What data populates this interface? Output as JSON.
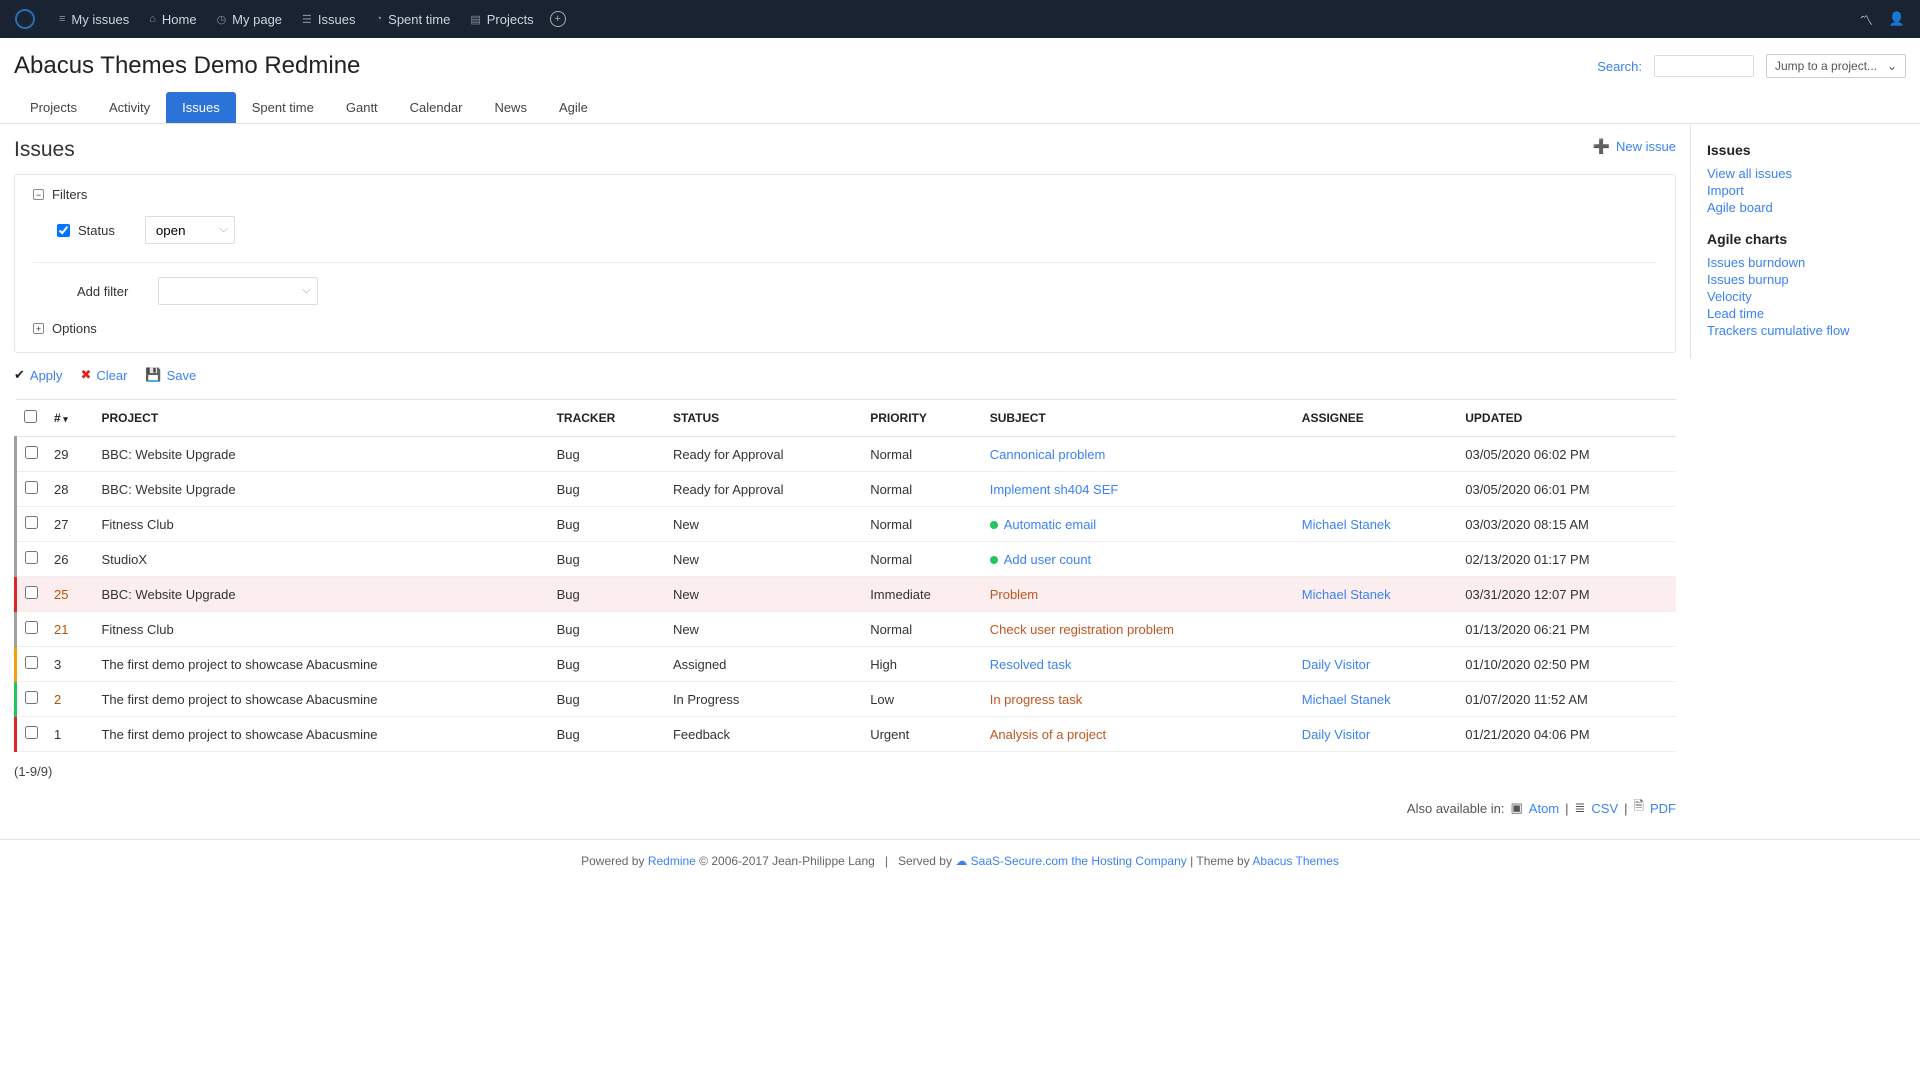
{
  "topnav": {
    "items": [
      {
        "icon": "≡",
        "label": "My issues"
      },
      {
        "icon": "⌂",
        "label": "Home"
      },
      {
        "icon": "◷",
        "label": "My page"
      },
      {
        "icon": "☰",
        "label": "Issues"
      },
      {
        "icon": "◔",
        "label": "Spent time"
      },
      {
        "icon": "▤",
        "label": "Projects"
      }
    ]
  },
  "header": {
    "title": "Abacus Themes Demo Redmine",
    "search_label": "Search:",
    "jump_label": "Jump to a project..."
  },
  "tabs": [
    "Projects",
    "Activity",
    "Issues",
    "Spent time",
    "Gantt",
    "Calendar",
    "News",
    "Agile"
  ],
  "tabs_active": "Issues",
  "page": {
    "title": "Issues",
    "new_issue": "New issue",
    "filters_label": "Filters",
    "status_label": "Status",
    "status_value": "open",
    "add_filter_label": "Add filter",
    "options_label": "Options",
    "apply": "Apply",
    "clear": "Clear",
    "save": "Save"
  },
  "columns": {
    "num": "#",
    "project": "PROJECT",
    "tracker": "TRACKER",
    "status": "STATUS",
    "priority": "PRIORITY",
    "subject": "SUBJECT",
    "assignee": "ASSIGNEE",
    "updated": "UPDATED"
  },
  "rows": [
    {
      "id": "29",
      "project": "BBC: Website Upgrade",
      "tracker": "Bug",
      "status": "Ready for Approval",
      "priority": "Normal",
      "subject": "Cannonical problem",
      "subject_style": "link",
      "assignee": "",
      "updated": "03/05/2020 06:02 PM",
      "stripe": "gray"
    },
    {
      "id": "28",
      "project": "BBC: Website Upgrade",
      "tracker": "Bug",
      "status": "Ready for Approval",
      "priority": "Normal",
      "subject": "Implement sh404 SEF",
      "subject_style": "link",
      "assignee": "",
      "updated": "03/05/2020 06:01 PM",
      "stripe": "gray"
    },
    {
      "id": "27",
      "project": "Fitness Club",
      "tracker": "Bug",
      "status": "New",
      "priority": "Normal",
      "subject": "Automatic email",
      "subject_style": "link",
      "dot": true,
      "assignee": "Michael Stanek",
      "updated": "03/03/2020 08:15 AM",
      "stripe": "gray"
    },
    {
      "id": "26",
      "project": "StudioX",
      "tracker": "Bug",
      "status": "New",
      "priority": "Normal",
      "subject": "Add user count",
      "subject_style": "link",
      "dot": true,
      "assignee": "",
      "updated": "02/13/2020 01:17 PM",
      "stripe": "gray"
    },
    {
      "id": "25",
      "id_red": true,
      "project": "BBC: Website Upgrade",
      "tracker": "Bug",
      "status": "New",
      "priority": "Immediate",
      "subject": "Problem",
      "subject_style": "red",
      "assignee": "Michael Stanek",
      "updated": "03/31/2020 12:07 PM",
      "stripe": "red",
      "highlight": true
    },
    {
      "id": "21",
      "id_red": true,
      "project": "Fitness Club",
      "tracker": "Bug",
      "status": "New",
      "priority": "Normal",
      "subject": "Check user registration problem",
      "subject_style": "red",
      "assignee": "",
      "updated": "01/13/2020 06:21 PM",
      "stripe": "gray"
    },
    {
      "id": "3",
      "project": "The first demo project to showcase Abacusmine",
      "tracker": "Bug",
      "status": "Assigned",
      "priority": "High",
      "subject": "Resolved task",
      "subject_style": "link",
      "assignee": "Daily Visitor",
      "updated": "01/10/2020 02:50 PM",
      "stripe": "orange"
    },
    {
      "id": "2",
      "id_red": true,
      "project": "The first demo project to showcase Abacusmine",
      "tracker": "Bug",
      "status": "In Progress",
      "priority": "Low",
      "subject": "In progress task",
      "subject_style": "red",
      "assignee": "Michael Stanek",
      "updated": "01/07/2020 11:52 AM",
      "stripe": "green"
    },
    {
      "id": "1",
      "project": "The first demo project to showcase Abacusmine",
      "tracker": "Bug",
      "status": "Feedback",
      "priority": "Urgent",
      "subject": "Analysis of a project",
      "subject_style": "red",
      "assignee": "Daily Visitor",
      "updated": "01/21/2020 04:06 PM",
      "stripe": "red"
    }
  ],
  "pager": "(1-9/9)",
  "also": {
    "label": "Also available in:",
    "atom": "Atom",
    "csv": "CSV",
    "pdf": "PDF"
  },
  "sidebar": {
    "h1": "Issues",
    "view_all": "View all issues",
    "import": "Import",
    "agile_board": "Agile board",
    "h2": "Agile charts",
    "burndown": "Issues burndown",
    "burnup": "Issues burnup",
    "velocity": "Velocity",
    "lead": "Lead time",
    "trackers": "Trackers cumulative flow"
  },
  "footer": {
    "powered": "Powered by ",
    "redmine": "Redmine",
    "copy": " © 2006-2017 Jean-Philippe Lang",
    "served": "Served by ",
    "saas": "SaaS-Secure.com the Hosting Company",
    "theme": " | Theme by ",
    "abacus": "Abacus Themes"
  }
}
